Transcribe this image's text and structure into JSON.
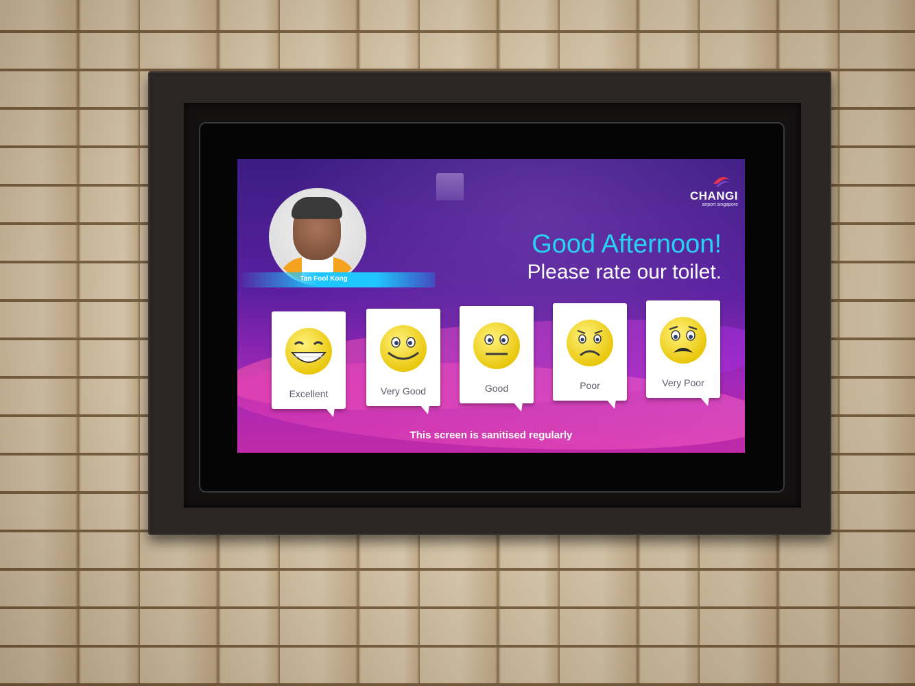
{
  "brand": {
    "name": "CHANGI",
    "sub": "airport singapore"
  },
  "attendant": {
    "name": "Tan Fool Kong"
  },
  "greeting": "Good Afternoon!",
  "prompt": "Please rate our toilet.",
  "ratings": [
    {
      "label": "Excellent",
      "icon": "grinning-face-icon"
    },
    {
      "label": "Very Good",
      "icon": "smiling-face-icon"
    },
    {
      "label": "Good",
      "icon": "neutral-face-icon"
    },
    {
      "label": "Poor",
      "icon": "frowning-face-icon"
    },
    {
      "label": "Very Poor",
      "icon": "worried-face-icon"
    }
  ],
  "footer": "This screen is sanitised regularly",
  "colors": {
    "greeting": "#27d3f2",
    "name_bar": "#1fc6ff",
    "emoji_yellow": "#f7e21a"
  }
}
